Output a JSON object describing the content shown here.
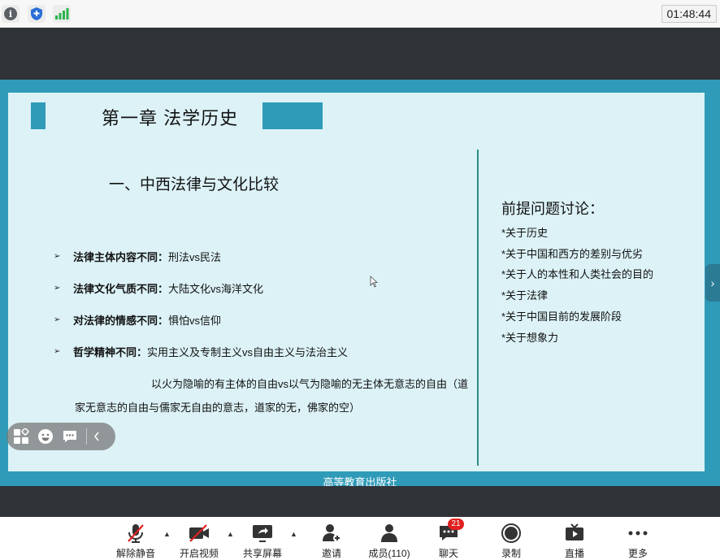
{
  "status_bar": {
    "timer": "01:48:44"
  },
  "slide": {
    "chapter_title": "第一章  法学历史",
    "section_title": "一、中西法律与文化比较",
    "comparisons": [
      {
        "label": "法律主体内容不同：",
        "text": "刑法vs民法"
      },
      {
        "label": "法律文化气质不同：",
        "text": "大陆文化vs海洋文化"
      },
      {
        "label": "对法律的情感不同：",
        "text": "惧怕vs信仰"
      },
      {
        "label": "哲学精神不同：",
        "text": "实用主义及专制主义vs自由主义与法治主义"
      }
    ],
    "paragraph_line1": "以火为隐喻的有主体的自由vs以气为隐喻的无主体无意志的自由（道",
    "paragraph_line2": "家无意志的自由与儒家无自由的意志，道家的无，佛家的空）",
    "discussion_title": "前提问题讨论：",
    "discussion_items": [
      "*关于历史",
      "*关于中国和西方的差别与优劣",
      "*关于人的本性和人类社会的目的",
      "*关于法律",
      "*关于中国目前的发展阶段",
      "*关于想象力"
    ],
    "publisher": "高等教育出版社"
  },
  "toolbar": {
    "unmute": "解除静音",
    "start_video": "开启视频",
    "share_screen": "共享屏幕",
    "invite": "邀请",
    "members": "成员(110)",
    "chat": "聊天",
    "chat_badge": "21",
    "record": "录制",
    "live": "直播",
    "more": "更多"
  },
  "colors": {
    "accent": "#2f9bb8",
    "slide_bg": "#dcf2f7",
    "divider": "#2e8e82",
    "badge": "#e02020"
  }
}
